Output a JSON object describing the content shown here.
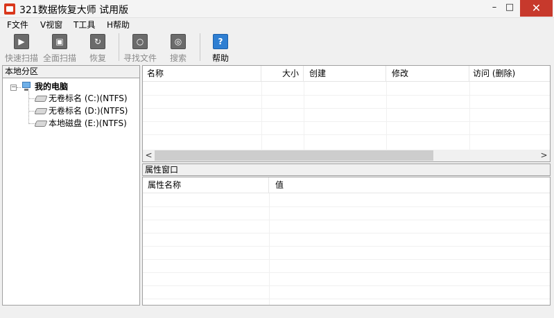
{
  "window": {
    "title": "321数据恢复大师 试用版",
    "minimize_glyph": "–",
    "maximize_glyph": "□",
    "close_glyph": "✕"
  },
  "menu": [
    "F文件",
    "V视窗",
    "T工具",
    "H帮助"
  ],
  "toolbar": {
    "quick_scan": "快速扫描",
    "full_scan": "全面扫描",
    "recover": "恢复",
    "find_file": "寻找文件",
    "search": "搜索",
    "help": "帮助",
    "help_glyph": "?"
  },
  "left_pane": {
    "header": "本地分区",
    "expander_glyph": "−",
    "root": "我的电脑",
    "drives": [
      "无卷标名 (C:)(NTFS)",
      "无卷标名 (D:)(NTFS)",
      "本地磁盘 (E:)(NTFS)"
    ]
  },
  "file_list": {
    "columns": [
      "名称",
      "大小",
      "创建",
      "修改",
      "访问 (删除)"
    ],
    "scroll_left": "<",
    "scroll_right": ">"
  },
  "properties": {
    "header": "属性窗口",
    "columns": [
      "属性名称",
      "值"
    ]
  },
  "colors": {
    "close_button": "#c7392c",
    "help_icon": "#2f7fd2"
  }
}
